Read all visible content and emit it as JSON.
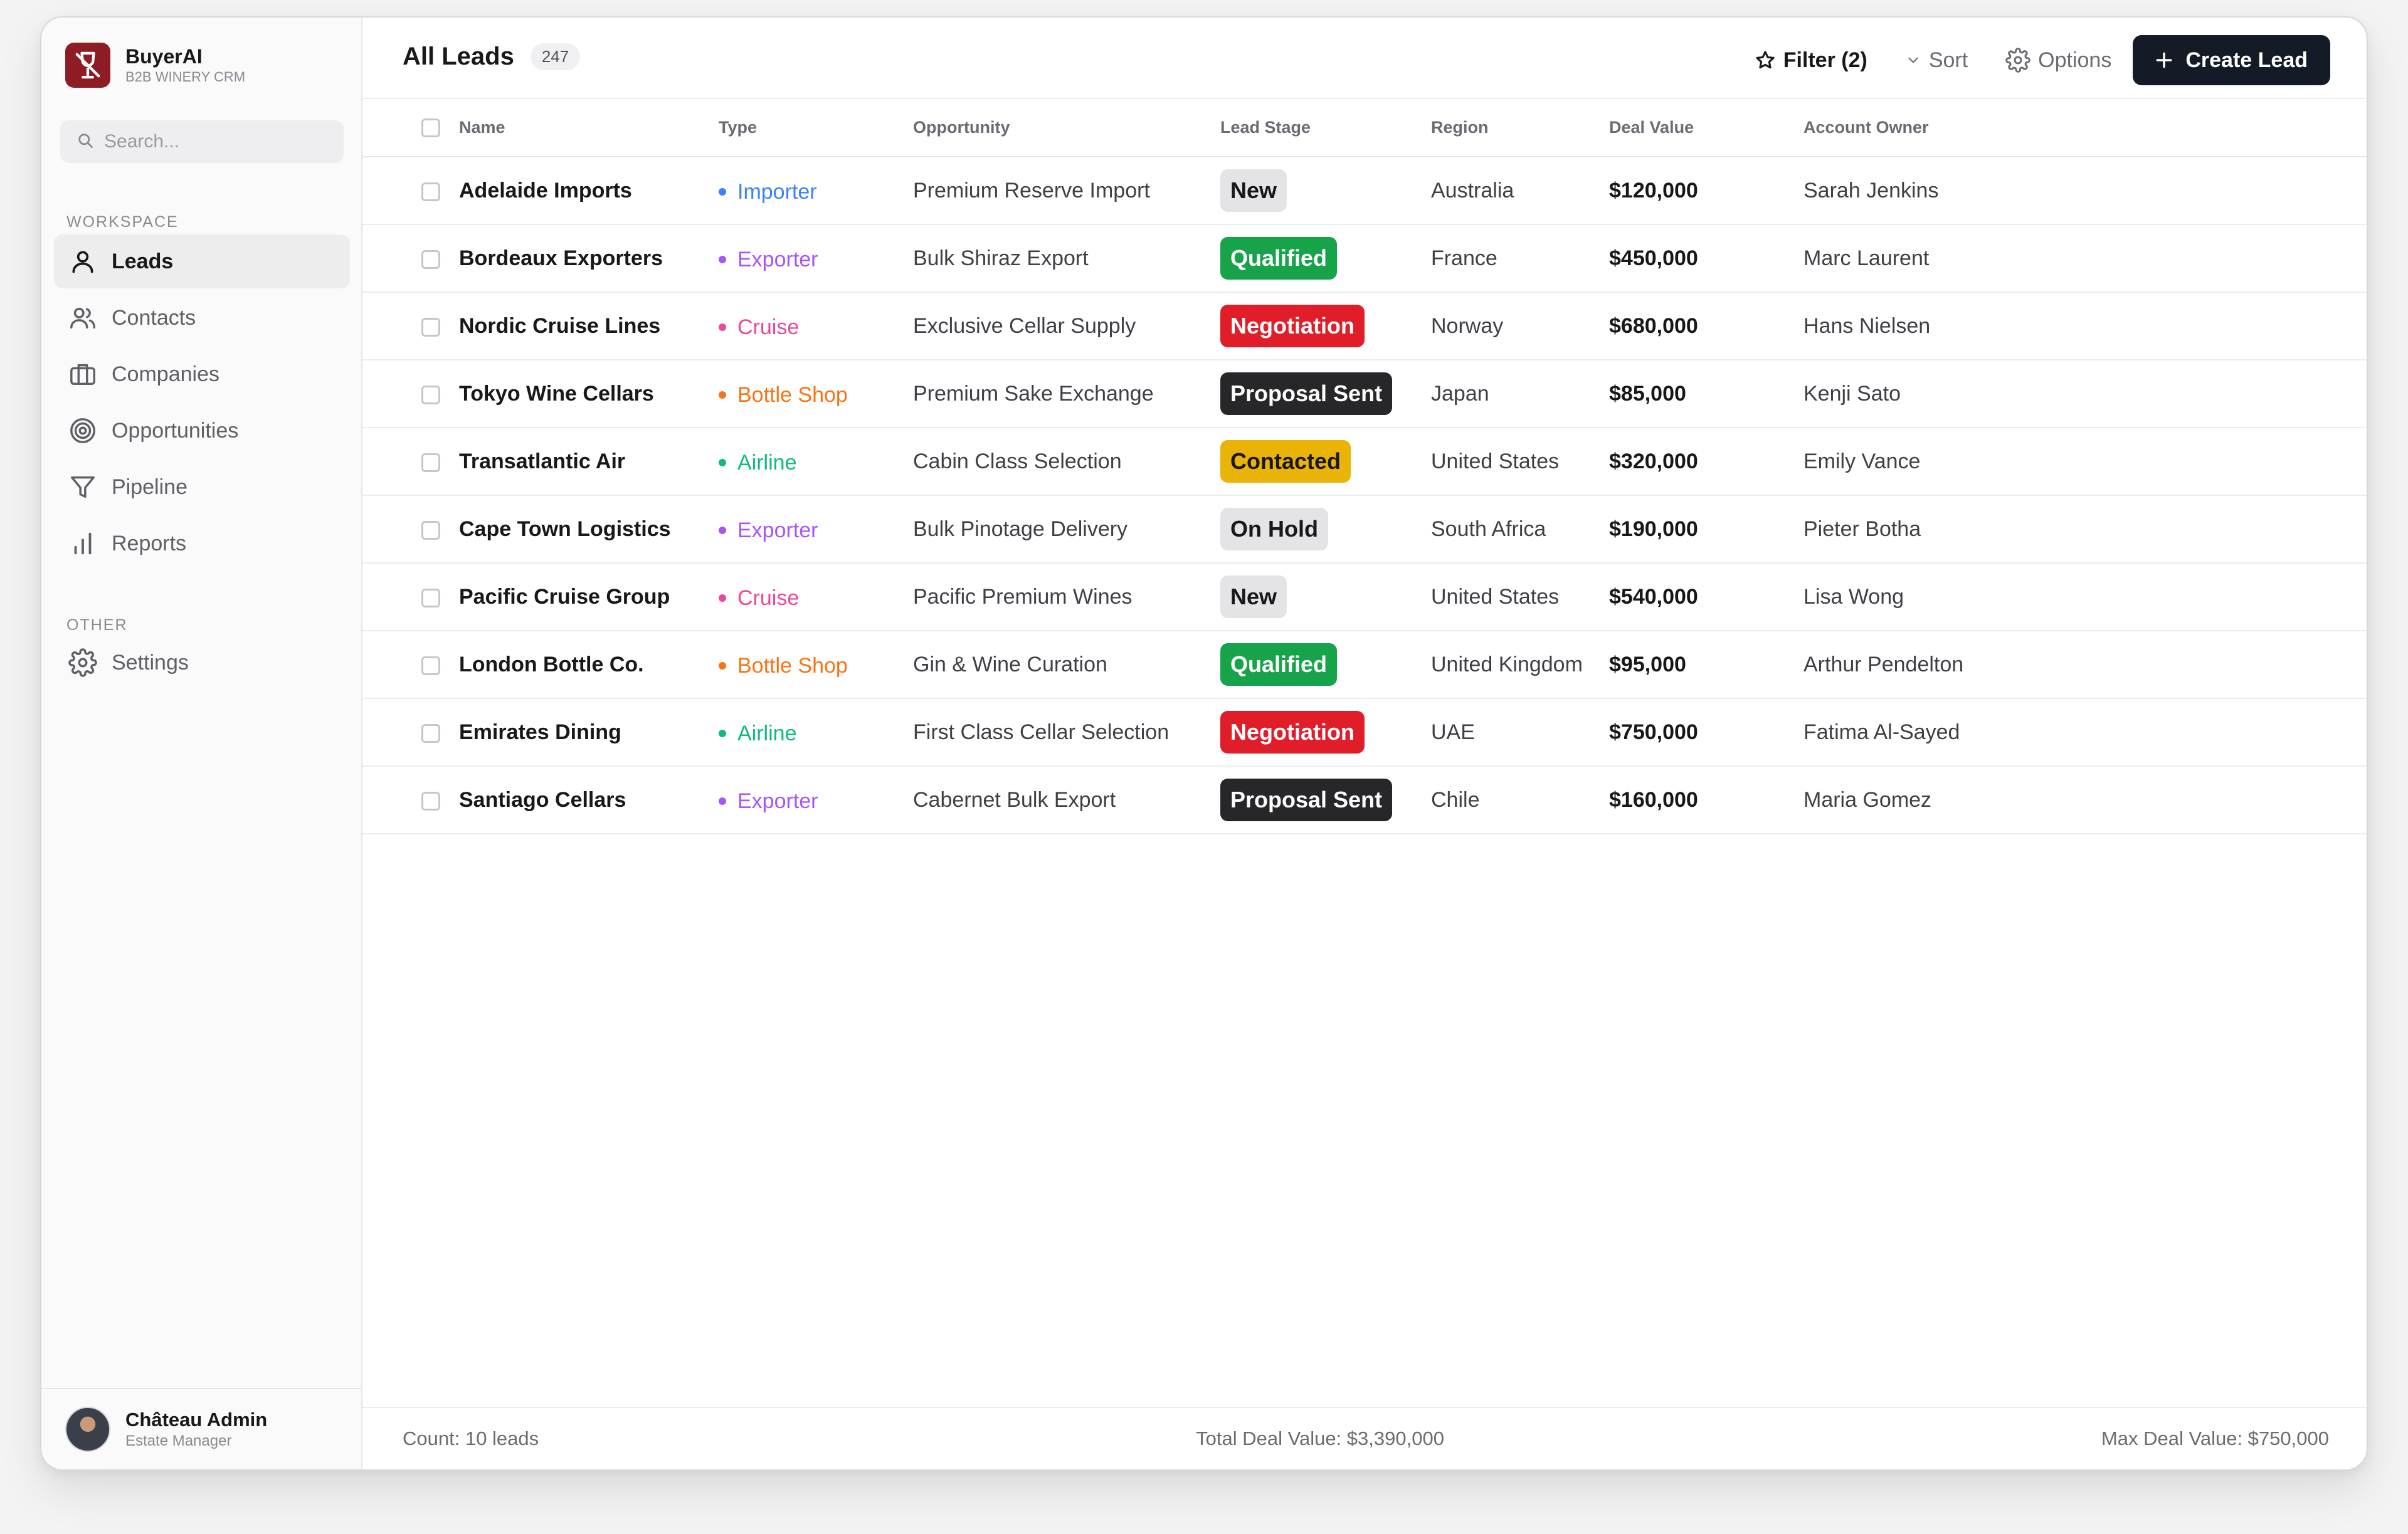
{
  "app": {
    "name": "BuyerAI",
    "subtitle": "B2B WINERY CRM"
  },
  "search": {
    "placeholder": "Search..."
  },
  "sidebar": {
    "workspace_label": "WORKSPACE",
    "other_label": "OTHER",
    "items": [
      {
        "label": "Leads",
        "icon": "user-icon",
        "active": true
      },
      {
        "label": "Contacts",
        "icon": "users-icon"
      },
      {
        "label": "Companies",
        "icon": "briefcase-icon"
      },
      {
        "label": "Opportunities",
        "icon": "target-icon"
      },
      {
        "label": "Pipeline",
        "icon": "funnel-icon"
      },
      {
        "label": "Reports",
        "icon": "bar-chart-icon"
      }
    ],
    "other_items": [
      {
        "label": "Settings",
        "icon": "gear-icon"
      }
    ]
  },
  "user": {
    "name": "Château Admin",
    "role": "Estate Manager"
  },
  "header": {
    "title": "All Leads",
    "count": "247",
    "filter_label": "Filter (2)",
    "sort_label": "Sort",
    "options_label": "Options",
    "create_label": "Create Lead"
  },
  "columns": [
    "Name",
    "Type",
    "Opportunity",
    "Lead Stage",
    "Region",
    "Deal Value",
    "Account Owner"
  ],
  "type_colors": {
    "Importer": "#3b82f6",
    "Exporter": "#a855f7",
    "Cruise": "#ec4899",
    "Bottle Shop": "#f97316",
    "Airline": "#10b981"
  },
  "stage_styles": {
    "New": {
      "bg": "#e4e4e7",
      "fg": "#18181b"
    },
    "Qualified": {
      "bg": "#16a34a",
      "fg": "#ffffff"
    },
    "Negotiation": {
      "bg": "#e11d2a",
      "fg": "#ffffff"
    },
    "Proposal Sent": {
      "bg": "#27272a",
      "fg": "#ffffff"
    },
    "Contacted": {
      "bg": "#eab308",
      "fg": "#18181b"
    },
    "On Hold": {
      "bg": "#e4e4e7",
      "fg": "#18181b"
    }
  },
  "rows": [
    {
      "name": "Adelaide Imports",
      "type": "Importer",
      "opportunity": "Premium Reserve Import",
      "stage": "New",
      "region": "Australia",
      "value": "$120,000",
      "owner": "Sarah Jenkins"
    },
    {
      "name": "Bordeaux Exporters",
      "type": "Exporter",
      "opportunity": "Bulk Shiraz Export",
      "stage": "Qualified",
      "region": "France",
      "value": "$450,000",
      "owner": "Marc Laurent"
    },
    {
      "name": "Nordic Cruise Lines",
      "type": "Cruise",
      "opportunity": "Exclusive Cellar Supply",
      "stage": "Negotiation",
      "region": "Norway",
      "value": "$680,000",
      "owner": "Hans Nielsen"
    },
    {
      "name": "Tokyo Wine Cellars",
      "type": "Bottle Shop",
      "opportunity": "Premium Sake Exchange",
      "stage": "Proposal Sent",
      "region": "Japan",
      "value": "$85,000",
      "owner": "Kenji Sato"
    },
    {
      "name": "Transatlantic Air",
      "type": "Airline",
      "opportunity": "Cabin Class Selection",
      "stage": "Contacted",
      "region": "United States",
      "value": "$320,000",
      "owner": "Emily Vance"
    },
    {
      "name": "Cape Town Logistics",
      "type": "Exporter",
      "opportunity": "Bulk Pinotage Delivery",
      "stage": "On Hold",
      "region": "South Africa",
      "value": "$190,000",
      "owner": "Pieter Botha"
    },
    {
      "name": "Pacific Cruise Group",
      "type": "Cruise",
      "opportunity": "Pacific Premium Wines",
      "stage": "New",
      "region": "United States",
      "value": "$540,000",
      "owner": "Lisa Wong"
    },
    {
      "name": "London Bottle Co.",
      "type": "Bottle Shop",
      "opportunity": "Gin & Wine Curation",
      "stage": "Qualified",
      "region": "United Kingdom",
      "value": "$95,000",
      "owner": "Arthur Pendelton"
    },
    {
      "name": "Emirates Dining",
      "type": "Airline",
      "opportunity": "First Class Cellar Selection",
      "stage": "Negotiation",
      "region": "UAE",
      "value": "$750,000",
      "owner": "Fatima Al-Sayed"
    },
    {
      "name": "Santiago Cellars",
      "type": "Exporter",
      "opportunity": "Cabernet Bulk Export",
      "stage": "Proposal Sent",
      "region": "Chile",
      "value": "$160,000",
      "owner": "Maria Gomez"
    }
  ],
  "footer": {
    "count": "Count: 10 leads",
    "total": "Total Deal Value: $3,390,000",
    "max": "Max Deal Value: $750,000"
  }
}
